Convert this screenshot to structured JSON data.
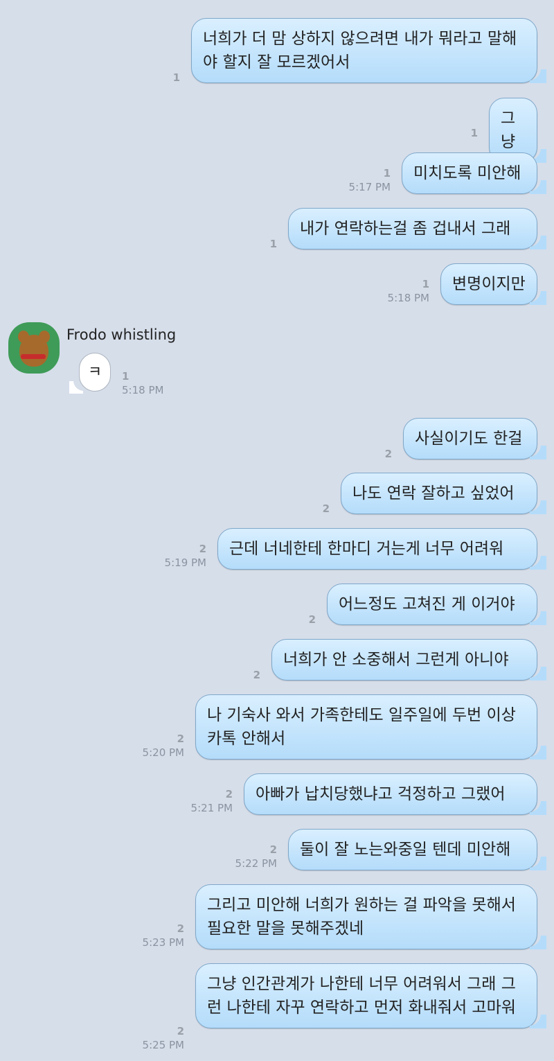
{
  "messages": {
    "m1": {
      "text": "너희가 더 맘 상하지 않으려면 내가 뭐라고 말해야 할지 잘 모르겠어서",
      "count": "1",
      "time": ""
    },
    "m2": {
      "text": "그냥",
      "count": "1",
      "time": ""
    },
    "m3": {
      "text": "미치도록 미안해",
      "count": "1",
      "time": "5:17 PM"
    },
    "m4": {
      "text": "내가 연락하는걸 좀 겁내서 그래",
      "count": "1",
      "time": ""
    },
    "m5": {
      "text": "변명이지만",
      "count": "1",
      "time": "5:18 PM"
    },
    "m7": {
      "text": "사실이기도 한걸",
      "count": "2",
      "time": ""
    },
    "m8": {
      "text": "나도 연락 잘하고 싶었어",
      "count": "2",
      "time": ""
    },
    "m9": {
      "text": "근데 너네한테 한마디 거는게 너무 어려워",
      "count": "2",
      "time": "5:19 PM"
    },
    "m10": {
      "text": "어느정도 고쳐진 게 이거야",
      "count": "2",
      "time": ""
    },
    "m11": {
      "text": "너희가 안 소중해서 그런게 아니야",
      "count": "2",
      "time": ""
    },
    "m12": {
      "text": "나 기숙사 와서 가족한테도 일주일에 두번 이상 카톡 안해서",
      "count": "2",
      "time": "5:20 PM"
    },
    "m13": {
      "text": "아빠가 납치당했냐고 걱정하고 그랬어",
      "count": "2",
      "time": "5:21 PM"
    },
    "m14": {
      "text": "둘이 잘 노는와중일 텐데 미안해",
      "count": "2",
      "time": "5:22 PM"
    },
    "m15": {
      "text": "그리고 미안해 너희가 원하는 걸 파악을 못해서 필요한 말을 못해주겠네",
      "count": "2",
      "time": "5:23 PM"
    },
    "m16": {
      "text": "그냥 인간관계가 나한테 너무 어려워서 그래 그런 나한테 자꾸 연락하고 먼저 화내줘서 고마워",
      "count": "2",
      "time": "5:25 PM"
    }
  },
  "incoming": {
    "sender": "Frodo whistling",
    "text": "ㅋ",
    "count": "1",
    "time": "5:18 PM",
    "avatar_icon": "frodo-character-avatar"
  }
}
